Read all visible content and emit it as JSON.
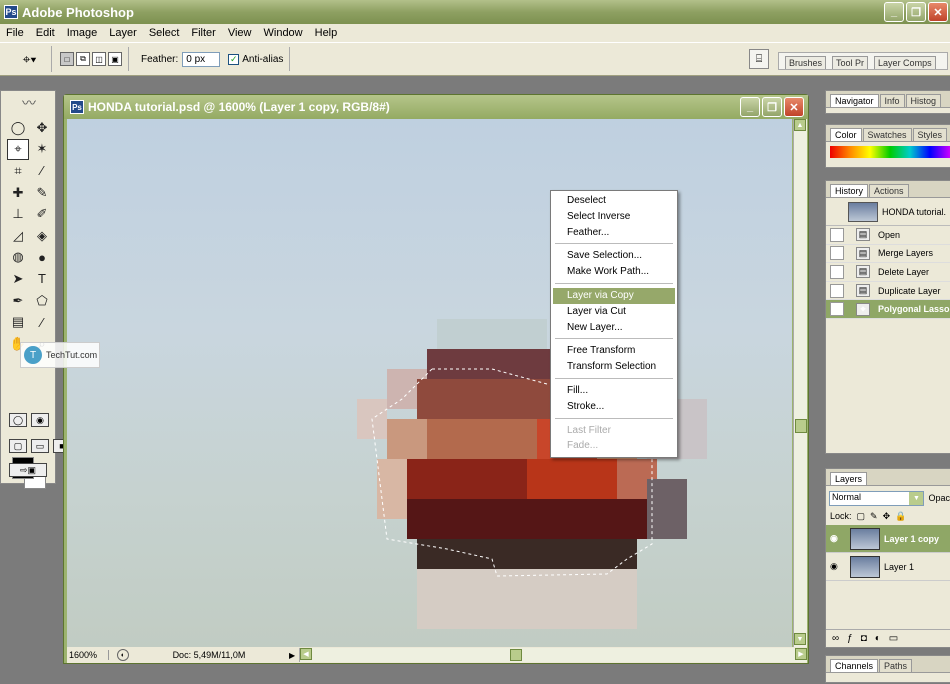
{
  "app": {
    "title": "Adobe Photoshop",
    "icon": "photoshop-icon"
  },
  "window_buttons": {
    "minimize": "_",
    "maximize": "❐",
    "close": "✕"
  },
  "menu": [
    "File",
    "Edit",
    "Image",
    "Layer",
    "Select",
    "Filter",
    "View",
    "Window",
    "Help"
  ],
  "options": {
    "tool_icon": "polygonal-lasso-icon",
    "feather_label": "Feather:",
    "feather_value": "0 px",
    "antialias_label": "Anti-alias",
    "antialias_checked": true,
    "well_tabs": [
      "Brushes",
      "Tool Pr",
      "Layer Comps"
    ]
  },
  "document": {
    "title": "HONDA tutorial.psd @ 1600% (Layer 1 copy, RGB/8#)",
    "zoom": "1600%",
    "doc_size": "Doc: 5,49M/11,0M"
  },
  "watermark": {
    "icon_letter": "T",
    "text": "TechTut.com"
  },
  "context_menu": {
    "groups": [
      [
        "Deselect",
        "Select Inverse",
        "Feather..."
      ],
      [
        "Save Selection...",
        "Make Work Path..."
      ],
      [
        "Layer via Copy",
        "Layer via Cut",
        "New Layer..."
      ],
      [
        "Free Transform",
        "Transform Selection"
      ],
      [
        "Fill...",
        "Stroke..."
      ],
      [
        "Last Filter",
        "Fade..."
      ]
    ],
    "selected": "Layer via Copy",
    "disabled": [
      "Last Filter",
      "Fade..."
    ]
  },
  "panels": {
    "navigator_tabs": [
      "Navigator",
      "Info",
      "Histog"
    ],
    "color_tabs": [
      "Color",
      "Swatches",
      "Styles"
    ],
    "history_tabs": [
      "History",
      "Actions"
    ],
    "history_snapshot": "HONDA tutorial.",
    "history_items": [
      "Open",
      "Merge Layers",
      "Delete Layer",
      "Duplicate Layer",
      "Polygonal Lasso"
    ],
    "history_current": "Polygonal Lasso",
    "layers_tab": "Layers",
    "blend_mode": "Normal",
    "opacity_label": "Opac",
    "lock_label": "Lock:",
    "layers": [
      "Layer 1 copy",
      "Layer 1"
    ],
    "layers_current": "Layer 1 copy",
    "bottom_tabs": [
      "Channels",
      "Paths"
    ]
  },
  "colors": {
    "accent": "#8fa766",
    "titlebar": "#8ea062",
    "foreground": "#000000",
    "background": "#ffffff"
  }
}
